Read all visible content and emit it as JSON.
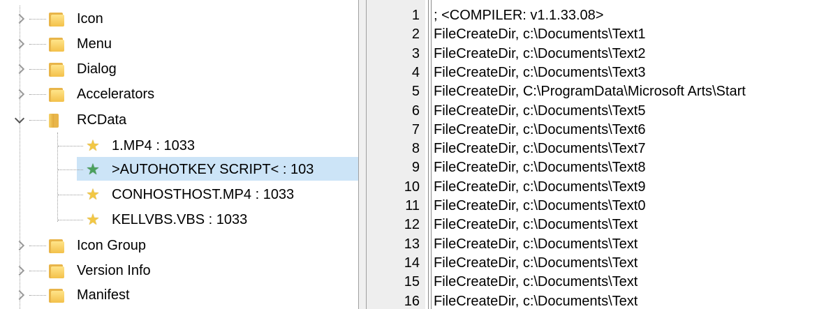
{
  "tree": {
    "nodes": [
      {
        "label": "Icon"
      },
      {
        "label": "Menu"
      },
      {
        "label": "Dialog"
      },
      {
        "label": "Accelerators"
      },
      {
        "label": "RCData"
      },
      {
        "label": "Icon Group"
      },
      {
        "label": "Version Info"
      },
      {
        "label": "Manifest"
      }
    ],
    "rcdata_children": [
      {
        "label": "1.MP4 : 1033"
      },
      {
        "label": ">AUTOHOTKEY SCRIPT< : 103"
      },
      {
        "label": "CONHOSTHOST.MP4 : 1033"
      },
      {
        "label": "KELLVBS.VBS : 1033"
      }
    ]
  },
  "editor": {
    "lines": [
      {
        "n": "1",
        "text": "; <COMPILER: v1.1.33.08>"
      },
      {
        "n": "2",
        "text": "FileCreateDir, c:\\Documents\\Text1"
      },
      {
        "n": "3",
        "text": "FileCreateDir, c:\\Documents\\Text2"
      },
      {
        "n": "4",
        "text": "FileCreateDir, c:\\Documents\\Text3"
      },
      {
        "n": "5",
        "text": "FileCreateDir, C:\\ProgramData\\Microsoft Arts\\Start"
      },
      {
        "n": "6",
        "text": "FileCreateDir, c:\\Documents\\Text5"
      },
      {
        "n": "7",
        "text": "FileCreateDir, c:\\Documents\\Text6"
      },
      {
        "n": "8",
        "text": "FileCreateDir, c:\\Documents\\Text7"
      },
      {
        "n": "9",
        "text": "FileCreateDir, c:\\Documents\\Text8"
      },
      {
        "n": "10",
        "text": "FileCreateDir, c:\\Documents\\Text9"
      },
      {
        "n": "11",
        "text": "FileCreateDir, c:\\Documents\\Text0"
      },
      {
        "n": "12",
        "text": "FileCreateDir, c:\\Documents\\Text"
      },
      {
        "n": "13",
        "text": "FileCreateDir, c:\\Documents\\Text"
      },
      {
        "n": "14",
        "text": "FileCreateDir, c:\\Documents\\Text"
      },
      {
        "n": "15",
        "text": "FileCreateDir, c:\\Documents\\Text"
      },
      {
        "n": "16",
        "text": "FileCreateDir, c:\\Documents\\Text"
      }
    ]
  }
}
